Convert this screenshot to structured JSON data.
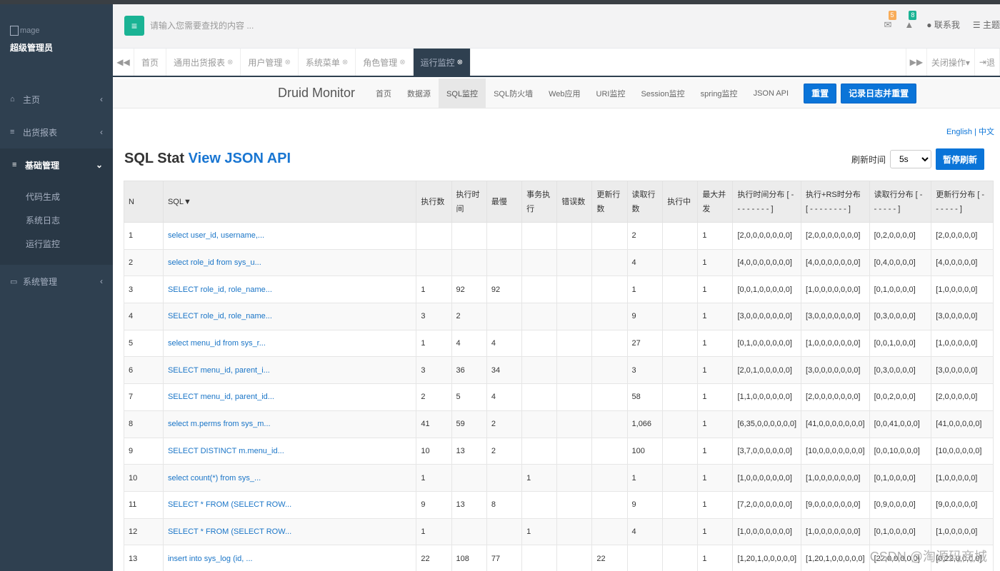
{
  "sidebar": {
    "image_alt": "mage",
    "role": "超级管理员",
    "items": [
      {
        "label": "主页",
        "icon": "home-icon",
        "glyph": "⌂"
      },
      {
        "label": "出货报表",
        "icon": "list-icon",
        "glyph": "≡"
      },
      {
        "label": "基础管理",
        "icon": "list-icon",
        "glyph": "≡"
      },
      {
        "label": "系统管理",
        "icon": "monitor-icon",
        "glyph": "▭"
      }
    ],
    "sub_items": [
      "代码生成",
      "系统日志",
      "运行监控"
    ]
  },
  "header": {
    "menu_glyph": "≡",
    "search_placeholder": "请输入您需要查找的内容 ...",
    "mail_badge": "5",
    "bell_badge": "8",
    "contact": "联系我",
    "theme": "主题"
  },
  "tabs": {
    "prev": "◀◀",
    "items": [
      "首页",
      "通用出货报表",
      "用户管理",
      "系统菜单",
      "角色管理",
      "运行监控"
    ],
    "next": "▶▶",
    "close_ops": "关闭操作▾",
    "exit": "退"
  },
  "druid": {
    "brand": "Druid Monitor",
    "nav": [
      "首页",
      "数据源",
      "SQL监控",
      "SQL防火墙",
      "Web应用",
      "URI监控",
      "Session监控",
      "spring监控",
      "JSON API"
    ],
    "btn_reset": "重置",
    "btn_log_reset": "记录日志并重置"
  },
  "content": {
    "lang": "English | 中文",
    "title_main": "SQL Stat",
    "title_link": "View JSON API",
    "refresh_label": "刷新时间",
    "refresh_value": "5s",
    "pause_label": "暂停刷新",
    "columns": [
      "N",
      "SQL▼",
      "执行数",
      "执行时间",
      "最慢",
      "事务执行",
      "错误数",
      "更新行数",
      "读取行数",
      "执行中",
      "最大并发",
      "执行时间分布 [ - - - - - - - - ]",
      "执行+RS时分布 [ - - - - - - - - ]",
      "读取行分布 [ - - - - - - ]",
      "更新行分布 [ - - - - - - ]"
    ],
    "rows": [
      [
        "1",
        "select user_id, username,...",
        "",
        "",
        "",
        "",
        "",
        "",
        "2",
        "",
        "1",
        "[2,0,0,0,0,0,0,0]",
        "[2,0,0,0,0,0,0,0]",
        "[0,2,0,0,0,0]",
        "[2,0,0,0,0,0]"
      ],
      [
        "2",
        "select role_id from sys_u...",
        "",
        "",
        "",
        "",
        "",
        "",
        "4",
        "",
        "1",
        "[4,0,0,0,0,0,0,0]",
        "[4,0,0,0,0,0,0,0]",
        "[0,4,0,0,0,0]",
        "[4,0,0,0,0,0]"
      ],
      [
        "3",
        "SELECT role_id, role_name...",
        "1",
        "92",
        "92",
        "",
        "",
        "",
        "1",
        "",
        "1",
        "[0,0,1,0,0,0,0,0]",
        "[1,0,0,0,0,0,0,0]",
        "[0,1,0,0,0,0]",
        "[1,0,0,0,0,0]"
      ],
      [
        "4",
        "SELECT role_id, role_name...",
        "3",
        "2",
        "",
        "",
        "",
        "",
        "9",
        "",
        "1",
        "[3,0,0,0,0,0,0,0]",
        "[3,0,0,0,0,0,0,0]",
        "[0,3,0,0,0,0]",
        "[3,0,0,0,0,0]"
      ],
      [
        "5",
        "select menu_id from sys_r...",
        "1",
        "4",
        "4",
        "",
        "",
        "",
        "27",
        "",
        "1",
        "[0,1,0,0,0,0,0,0]",
        "[1,0,0,0,0,0,0,0]",
        "[0,0,1,0,0,0]",
        "[1,0,0,0,0,0]"
      ],
      [
        "6",
        "SELECT menu_id, parent_i...",
        "3",
        "36",
        "34",
        "",
        "",
        "",
        "3",
        "",
        "1",
        "[2,0,1,0,0,0,0,0]",
        "[3,0,0,0,0,0,0,0]",
        "[0,3,0,0,0,0]",
        "[3,0,0,0,0,0]"
      ],
      [
        "7",
        "SELECT menu_id, parent_id...",
        "2",
        "5",
        "4",
        "",
        "",
        "",
        "58",
        "",
        "1",
        "[1,1,0,0,0,0,0,0]",
        "[2,0,0,0,0,0,0,0]",
        "[0,0,2,0,0,0]",
        "[2,0,0,0,0,0]"
      ],
      [
        "8",
        "select m.perms from sys_m...",
        "41",
        "59",
        "2",
        "",
        "",
        "",
        "1,066",
        "",
        "1",
        "[6,35,0,0,0,0,0,0]",
        "[41,0,0,0,0,0,0,0]",
        "[0,0,41,0,0,0]",
        "[41,0,0,0,0,0]"
      ],
      [
        "9",
        "SELECT DISTINCT m.menu_id...",
        "10",
        "13",
        "2",
        "",
        "",
        "",
        "100",
        "",
        "1",
        "[3,7,0,0,0,0,0,0]",
        "[10,0,0,0,0,0,0,0]",
        "[0,0,10,0,0,0]",
        "[10,0,0,0,0,0]"
      ],
      [
        "10",
        "select count(*) from sys_...",
        "1",
        "",
        "",
        "1",
        "",
        "",
        "1",
        "",
        "1",
        "[1,0,0,0,0,0,0,0]",
        "[1,0,0,0,0,0,0,0]",
        "[0,1,0,0,0,0]",
        "[1,0,0,0,0,0]"
      ],
      [
        "11",
        "SELECT * FROM (SELECT ROW...",
        "9",
        "13",
        "8",
        "",
        "",
        "",
        "9",
        "",
        "1",
        "[7,2,0,0,0,0,0,0]",
        "[9,0,0,0,0,0,0,0]",
        "[0,9,0,0,0,0]",
        "[9,0,0,0,0,0]"
      ],
      [
        "12",
        "SELECT * FROM (SELECT ROW...",
        "1",
        "",
        "",
        "1",
        "",
        "",
        "4",
        "",
        "1",
        "[1,0,0,0,0,0,0,0]",
        "[1,0,0,0,0,0,0,0]",
        "[0,1,0,0,0,0]",
        "[1,0,0,0,0,0]"
      ],
      [
        "13",
        "insert into sys_log (id, ...",
        "22",
        "108",
        "77",
        "",
        "",
        "22",
        "",
        "",
        "1",
        "[1,20,1,0,0,0,0,0]",
        "[1,20,1,0,0,0,0,0]",
        "[22,0,0,0,0,0]",
        "[0,22,0,0,0,0]"
      ]
    ],
    "watermark": "CSDN @淘源码商城"
  },
  "colors": {
    "sidebar_bg": "#2f4050",
    "accent_green": "#1ab394",
    "primary_blue": "#0a74d8"
  }
}
